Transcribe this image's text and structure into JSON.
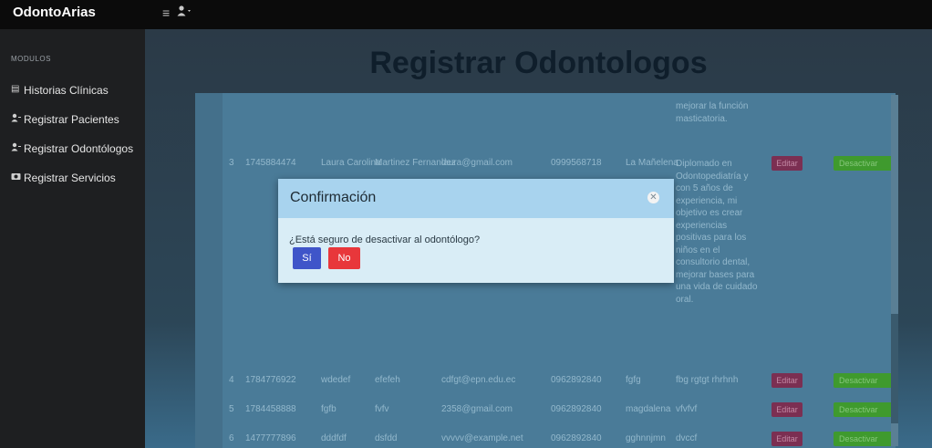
{
  "app": {
    "brand": "OdontoArias",
    "menu_icon": "hamburger-icon",
    "user_icon": "user-icon"
  },
  "sidebar": {
    "section": "MODULOS",
    "items": [
      {
        "label": "Historias Clínicas",
        "icon": "book-icon"
      },
      {
        "label": "Registrar Pacientes",
        "icon": "user-plus-icon"
      },
      {
        "label": "Registrar Odontólogos",
        "icon": "user-plus-icon"
      },
      {
        "label": "Registrar Servicios",
        "icon": "camera-icon"
      }
    ]
  },
  "page": {
    "title": "Registrar Odontologos"
  },
  "table": {
    "prev_desc_tail": "mejorar la función masticatoria.",
    "rows": [
      {
        "num": "3",
        "id": "1745884474",
        "name": "Laura Carolina",
        "surname": "Martinez Fernandez",
        "email": "laura@gmail.com",
        "phone": "0999568718",
        "address": "La Mañelena",
        "desc": "Diplomado en Odontopediatría y con 5 años de experiencia, mi objetivo es crear experiencias positivas para los niños en el consultorio dental, mejorar bases para una vida de cuidado oral.",
        "edit": "Editar",
        "deact": "Desactivar"
      },
      {
        "num": "4",
        "id": "1784776922",
        "name": "wdedef",
        "surname": "efefeh",
        "email": "cdfgt@epn.edu.ec",
        "phone": "0962892840",
        "address": "fgfg",
        "desc": "fbg rgtgt rhrhnh",
        "edit": "Editar",
        "deact": "Desactivar"
      },
      {
        "num": "5",
        "id": "1784458888",
        "name": "fgfb",
        "surname": "fvfv",
        "email": "2358@gmail.com",
        "phone": "0962892840",
        "address": "magdalena",
        "desc": "vfvfvf",
        "edit": "Editar",
        "deact": "Desactivar"
      },
      {
        "num": "6",
        "id": "1477777896",
        "name": "dddfdf",
        "surname": "dsfdd",
        "email": "vvvvv@example.net",
        "phone": "0962892840",
        "address": "gghnnjmn",
        "desc": "dvccf",
        "edit": "Editar",
        "deact": "Desactivar"
      }
    ]
  },
  "modal": {
    "title": "Confirmación",
    "close_icon": "close-circle-icon",
    "message": "¿Está seguro de desactivar al odontólogo?",
    "yes": "Sí",
    "no": "No"
  },
  "colors": {
    "topbar": "#0b0b0b",
    "sidebar": "#1e1f21",
    "modal_header": "#a8d3ee",
    "modal_body": "#d9edf6",
    "yes_button": "#3f55c9",
    "no_button": "#e8373b",
    "edit_button": "#a6316e",
    "deactivate_button": "#4fc52e"
  }
}
